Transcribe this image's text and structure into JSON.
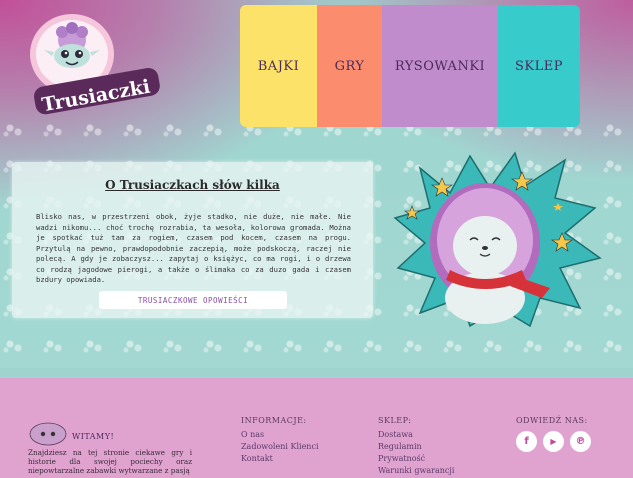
{
  "brand": {
    "logo_text": "Trusiaczki"
  },
  "nav": {
    "items": [
      "BAJKI",
      "GRY",
      "RYSOWANKI",
      "SKLEP"
    ]
  },
  "about": {
    "title": "O Trusiaczkach słów kilka",
    "text": "Blisko nas, w przestrzeni obok, żyje stadko, nie duże, nie małe. Nie wadzi nikomu... choć trochę rozrabia, ta wesoła, kolorowa gromada. Można je spotkać tuż tam za rogiem, czasem pod kocem, czasem na progu. Przytulą na pewno, prawdopodobnie zaczepią, może podskoczą, raczej nie polecą. A gdy je zobaczysz... zapytaj o księżyc, co ma rogi, i o drzewa co rodzą jagodowe pierogi, a także o ślimaka co za duzo gada i czasem bzdury opowiada.",
    "button": "TRUSIACZKOWE OPOWIEŚCI"
  },
  "footer": {
    "welcome_title": "WITAMY!",
    "welcome_text": "Znajdziesz na tej stronie ciekawe gry i historie dla swojej pociechy oraz niepowtarzalne zabawki wytwarzane z pasją",
    "info": {
      "title": "INFORMACJE:",
      "links": [
        "O nas",
        "Zadowoleni Klienci",
        "Kontakt"
      ]
    },
    "shop": {
      "title": "SKLEP:",
      "links": [
        "Dostawa",
        "Regulamin",
        "Prywatność",
        "Warunki gwarancji"
      ]
    },
    "social": {
      "title": "ODWIEDŹ NAS:",
      "icons": [
        "facebook-icon",
        "youtube-icon",
        "pinterest-icon"
      ],
      "glyphs": [
        "f",
        "▶",
        "℗"
      ]
    }
  },
  "colors": {
    "nav_bajki": "#fde26a",
    "nav_gry": "#fb8d6e",
    "nav_rysowanki": "#c18ccc",
    "nav_sklep": "#37cbcb",
    "footer": "#e0a3cf",
    "accent": "#c4489a"
  }
}
